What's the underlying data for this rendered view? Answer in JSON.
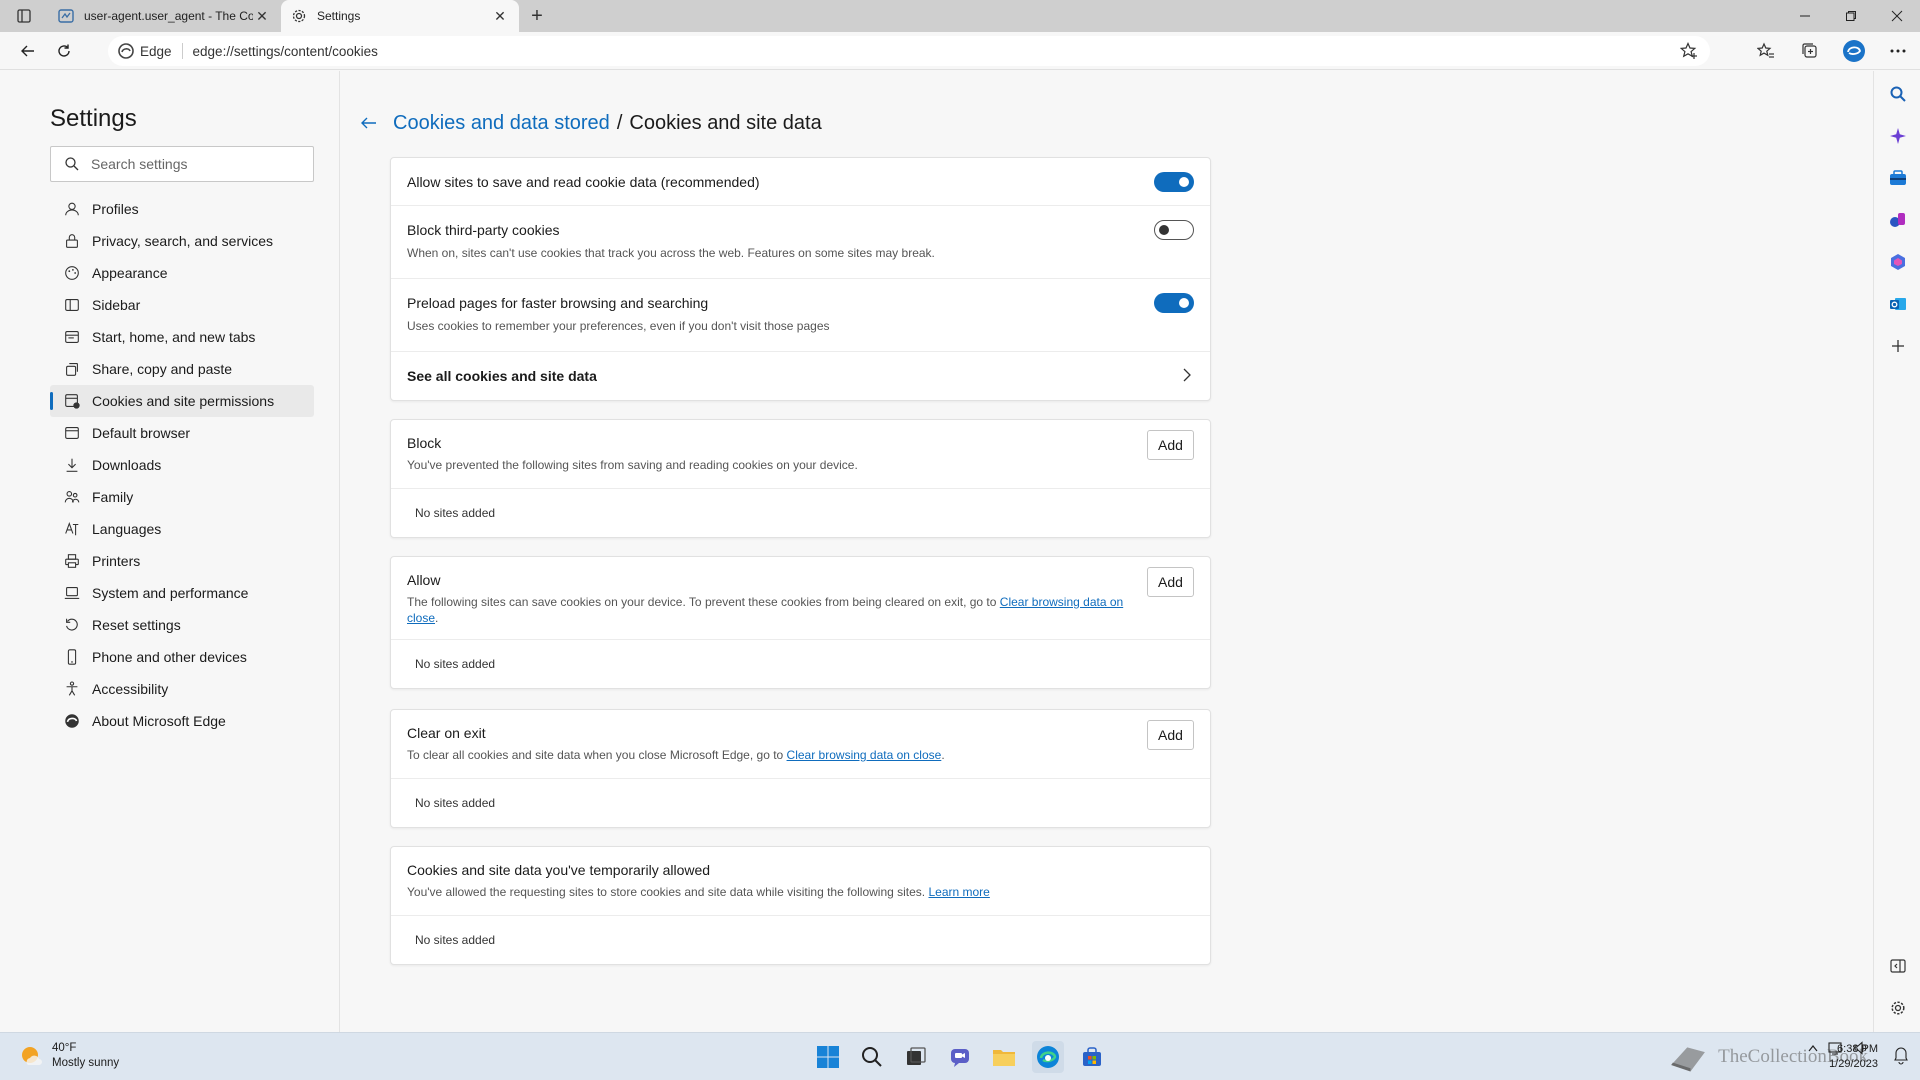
{
  "tabs": [
    {
      "title": "user-agent.user_agent - The Coll",
      "active": false
    },
    {
      "title": "Settings",
      "active": true
    }
  ],
  "address": {
    "brand": "Edge",
    "url": "edge://settings/content/cookies"
  },
  "settings": {
    "title": "Settings",
    "search_placeholder": "Search settings",
    "nav": [
      {
        "label": "Profiles",
        "icon": "profile-icon"
      },
      {
        "label": "Privacy, search, and services",
        "icon": "lock-icon"
      },
      {
        "label": "Appearance",
        "icon": "appearance-icon"
      },
      {
        "label": "Sidebar",
        "icon": "sidebar-icon"
      },
      {
        "label": "Start, home, and new tabs",
        "icon": "home-icon"
      },
      {
        "label": "Share, copy and paste",
        "icon": "share-icon"
      },
      {
        "label": "Cookies and site permissions",
        "icon": "cookie-permissions-icon",
        "selected": true
      },
      {
        "label": "Default browser",
        "icon": "browser-icon"
      },
      {
        "label": "Downloads",
        "icon": "download-icon"
      },
      {
        "label": "Family",
        "icon": "family-icon"
      },
      {
        "label": "Languages",
        "icon": "languages-icon"
      },
      {
        "label": "Printers",
        "icon": "printer-icon"
      },
      {
        "label": "System and performance",
        "icon": "laptop-icon"
      },
      {
        "label": "Reset settings",
        "icon": "reset-icon"
      },
      {
        "label": "Phone and other devices",
        "icon": "phone-icon"
      },
      {
        "label": "Accessibility",
        "icon": "accessibility-icon"
      },
      {
        "label": "About Microsoft Edge",
        "icon": "edge-icon"
      }
    ]
  },
  "page": {
    "breadcrumb_parent": "Cookies and data stored",
    "breadcrumb_sep": "/",
    "breadcrumb_current": "Cookies and site data",
    "options": {
      "allow_sites": {
        "label": "Allow sites to save and read cookie data (recommended)",
        "on": true
      },
      "block_third_party": {
        "label": "Block third-party cookies",
        "desc": "When on, sites can't use cookies that track you across the web. Features on some sites may break.",
        "on": false
      },
      "preload": {
        "label": "Preload pages for faster browsing and searching",
        "desc": "Uses cookies to remember your preferences, even if you don't visit those pages",
        "on": true
      },
      "see_all": {
        "label": "See all cookies and site data"
      }
    },
    "block": {
      "title": "Block",
      "desc": "You've prevented the following sites from saving and reading cookies on your device.",
      "add": "Add",
      "empty": "No sites added"
    },
    "allow": {
      "title": "Allow",
      "desc": "The following sites can save cookies on your device. To prevent these cookies from being cleared on exit, go to ",
      "link": "Clear browsing data on close",
      "end": ".",
      "add": "Add",
      "empty": "No sites added"
    },
    "clear_on_exit": {
      "title": "Clear on exit",
      "desc": "To clear all cookies and site data when you close Microsoft Edge, go to ",
      "link": "Clear browsing data on close",
      "end": ".",
      "add": "Add",
      "empty": "No sites added"
    },
    "temp_allowed": {
      "title": "Cookies and site data you've temporarily allowed",
      "desc": "You've allowed the requesting sites to store cookies and site data while visiting the following sites. ",
      "link": "Learn more",
      "empty": "No sites added"
    }
  },
  "taskbar": {
    "temp": "40°F",
    "condition": "Mostly sunny",
    "time": "6:38 PM",
    "date": "1/29/2023",
    "watermark": "TheCollectionBook"
  },
  "colors": {
    "accent": "#0f6cbd",
    "taskbar": "#dde6f0"
  }
}
